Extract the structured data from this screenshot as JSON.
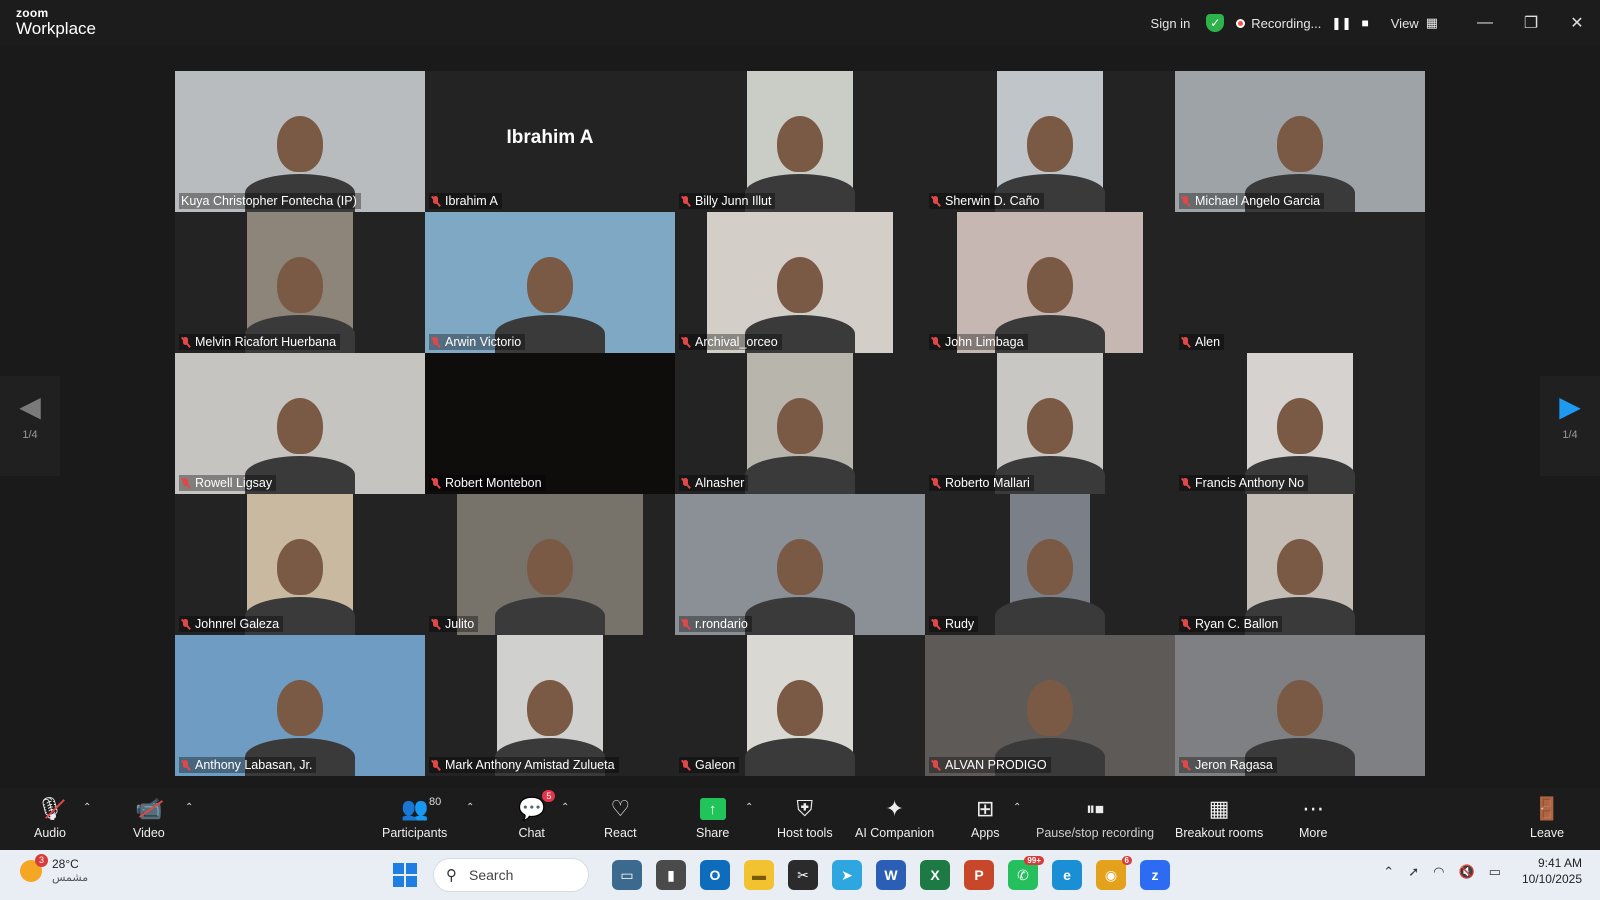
{
  "window": {
    "brand_small": "zoom",
    "brand_large": "Workplace",
    "sign_in": "Sign in",
    "recording_label": "Recording...",
    "view_label": "View"
  },
  "gallery": {
    "page_indicator_left": "1/4",
    "page_indicator_right": "1/4",
    "tiles": [
      {
        "name": "Kuya Christopher Fontecha (IP)",
        "active": true,
        "video": "full",
        "bg": "#b9bcbe"
      },
      {
        "name": "Ibrahim A",
        "big_name": "Ibrahim A",
        "video": "none"
      },
      {
        "name": "Billy Junn Illut",
        "video": "narrow",
        "bg": "#c9cdc6"
      },
      {
        "name": "Sherwin D. Caño",
        "video": "narrow",
        "bg": "#bfc5c9"
      },
      {
        "name": "Michael Angelo Garcia",
        "video": "full",
        "bg": "#9da3a6"
      },
      {
        "name": "Melvin Ricafort Huerbana",
        "video": "narrow",
        "bg": "#8e857a"
      },
      {
        "name": "Arwin Victorio",
        "video": "full",
        "bg": "#7fa8c4"
      },
      {
        "name": "Archival_orceo",
        "video": "wide",
        "bg": "#d3cfc8"
      },
      {
        "name": "John Limbaga",
        "video": "wide",
        "bg": "#c7b7b2"
      },
      {
        "name": "Alen",
        "video": "none"
      },
      {
        "name": "Rowell Ligsay",
        "video": "full",
        "bg": "#c6c4c0"
      },
      {
        "name": "Robert Montebon",
        "video": "dark",
        "bg": "#0f0c0c"
      },
      {
        "name": "Alnasher",
        "video": "narrow",
        "bg": "#b8b5ad"
      },
      {
        "name": "Roberto Mallari",
        "video": "narrow",
        "bg": "#c8c7c3"
      },
      {
        "name": "Francis Anthony No",
        "video": "narrow",
        "bg": "#d6d2cf"
      },
      {
        "name": "Johnrel Galeza",
        "video": "narrow",
        "bg": "#c9b9a0"
      },
      {
        "name": "Julito",
        "video": "wide",
        "bg": "#77726a"
      },
      {
        "name": "r.rondario",
        "video": "full",
        "bg": "#8b9096"
      },
      {
        "name": "Rudy",
        "video": "slim",
        "bg": "#7b7f88"
      },
      {
        "name": "Ryan C. Ballon",
        "video": "narrow",
        "bg": "#c3bdb5"
      },
      {
        "name": "Anthony Labasan, Jr.",
        "video": "full",
        "bg": "#6f9cc2"
      },
      {
        "name": "Mark Anthony Amistad Zulueta",
        "video": "narrow",
        "bg": "#d0d0cf"
      },
      {
        "name": "Galeon",
        "video": "narrow",
        "bg": "#d9d8d3"
      },
      {
        "name": "ALVAN PRODIGO",
        "video": "full",
        "bg": "#5e5a58"
      },
      {
        "name": "Jeron Ragasa",
        "video": "full",
        "bg": "#7e8083"
      }
    ]
  },
  "toolbar": {
    "audio": "Audio",
    "video": "Video",
    "participants": "Participants",
    "participants_count": "80",
    "chat": "Chat",
    "chat_badge": "5",
    "react": "React",
    "share": "Share",
    "host_tools": "Host tools",
    "ai_companion": "AI Companion",
    "apps": "Apps",
    "pause_stop_recording": "Pause/stop recording",
    "breakout_rooms": "Breakout rooms",
    "more": "More",
    "leave": "Leave"
  },
  "taskbar": {
    "temperature": "28°C",
    "condition": "مشمس",
    "weather_badge": "3",
    "search_placeholder": "Search",
    "whatsapp_badge": "99+",
    "chrome_badge": "6",
    "time": "9:41 AM",
    "date": "10/10/2025"
  },
  "colors": {
    "active_speaker": "#23d96a",
    "recording": "#ff4d4d",
    "share_green": "#21c45b",
    "next_page_arrow": "#1e9bf0"
  }
}
